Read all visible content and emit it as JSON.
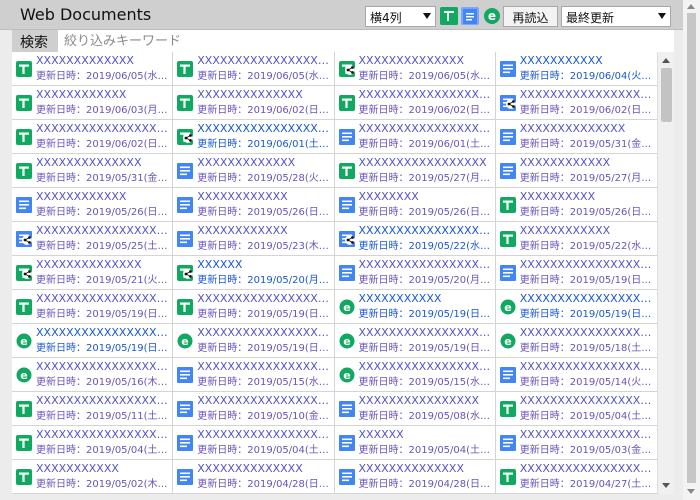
{
  "header": {
    "title": "Web Documents",
    "columns_select": "横4列",
    "reload_label": "再読込",
    "sort_select": "最終更新"
  },
  "search": {
    "label": "検索",
    "placeholder": "絞り込みキーワード"
  },
  "icons": {
    "sheets": {
      "name": "sheets-icon",
      "color": "#11a861"
    },
    "sheets-shared": {
      "name": "sheets-shared-icon",
      "color": "#11a861"
    },
    "docs": {
      "name": "docs-icon",
      "color": "#4285f4"
    },
    "docs-shared": {
      "name": "docs-shared-icon",
      "color": "#4285f4"
    },
    "e": {
      "name": "e-doc-icon",
      "color": "#11a861"
    }
  },
  "items": [
    {
      "type": "sheets",
      "name": "XXXXXXXXXXXXX",
      "meta": "更新日時：2019/06/05(水…",
      "new": false
    },
    {
      "type": "sheets",
      "name": "XXXXXXXXXXXXXXXXXX…",
      "meta": "更新日時：2019/06/05(水…",
      "new": false
    },
    {
      "type": "sheets-shared",
      "name": "XXXXXXXXXXXXXX",
      "meta": "更新日時：2019/06/05(水…",
      "new": false
    },
    {
      "type": "docs",
      "name": "XXXXXXXXXXX",
      "meta": "更新日時：2019/06/04(火…",
      "new": true
    },
    {
      "type": "sheets",
      "name": "XXXXXXXXXXXX",
      "meta": "更新日時：2019/06/03(月…",
      "new": false
    },
    {
      "type": "sheets",
      "name": "XXXXXXXXXXXXXX",
      "meta": "更新日時：2019/06/02(日…",
      "new": false
    },
    {
      "type": "sheets",
      "name": "XXXXXXXXXXXXXXXXXX…",
      "meta": "更新日時：2019/06/02(日…",
      "new": false
    },
    {
      "type": "docs-shared",
      "name": "XXXXXXXXXXXXXXXXXX…",
      "meta": "更新日時：2019/06/02(日…",
      "new": false
    },
    {
      "type": "sheets",
      "name": "XXXXXXXXXXXXXXXXXX…",
      "meta": "更新日時：2019/06/02(日…",
      "new": false
    },
    {
      "type": "sheets-shared",
      "name": "XXXXXXXXXXXXXXXXXX…",
      "meta": "更新日時：2019/06/01(土…",
      "new": true
    },
    {
      "type": "docs",
      "name": "XXXXXXXXXXXXXXXXXX…",
      "meta": "更新日時：2019/06/01(土…",
      "new": false
    },
    {
      "type": "docs",
      "name": "XXXXXXXXXXXXXX",
      "meta": "更新日時：2019/05/31(金…",
      "new": false
    },
    {
      "type": "sheets",
      "name": "XXXXXXXXXXXXXX",
      "meta": "更新日時：2019/05/31(金…",
      "new": false
    },
    {
      "type": "docs",
      "name": "XXXXXXXXXXXXX",
      "meta": "更新日時：2019/05/28(火…",
      "new": false
    },
    {
      "type": "sheets",
      "name": "XXXXXXXXXXXXXXXXX",
      "meta": "更新日時：2019/05/27(月…",
      "new": false
    },
    {
      "type": "docs",
      "name": "XXXXXXXXXXXX",
      "meta": "更新日時：2019/05/27(月…",
      "new": false
    },
    {
      "type": "docs",
      "name": "XXXXXXXXXXXX",
      "meta": "更新日時：2019/05/26(日…",
      "new": false
    },
    {
      "type": "docs",
      "name": "XXXXXXXXXXXX",
      "meta": "更新日時：2019/05/26(日…",
      "new": false
    },
    {
      "type": "docs",
      "name": "XXXXXXXX",
      "meta": "更新日時：2019/05/26(日…",
      "new": false
    },
    {
      "type": "sheets",
      "name": "XXXXXXXXXX",
      "meta": "更新日時：2019/05/26(日…",
      "new": false
    },
    {
      "type": "docs-shared",
      "name": "XXXXXXXXXXXXXXXXXX…",
      "meta": "更新日時：2019/05/25(土…",
      "new": false
    },
    {
      "type": "docs",
      "name": "XXXXXXXXXXXX",
      "meta": "更新日時：2019/05/23(木…",
      "new": false
    },
    {
      "type": "docs-shared",
      "name": "XXXXXXXXXXXXXXXXXX…",
      "meta": "更新日時：2019/05/22(水…",
      "new": true
    },
    {
      "type": "sheets",
      "name": "XXXXXXXXXXXX",
      "meta": "更新日時：2019/05/22(水…",
      "new": false
    },
    {
      "type": "sheets-shared",
      "name": "XXXXXXXXXXXXXX",
      "meta": "更新日時：2019/05/21(火…",
      "new": false
    },
    {
      "type": "sheets-shared",
      "name": "XXXXXX",
      "meta": "更新日時：2019/05/20(月…",
      "new": true
    },
    {
      "type": "docs",
      "name": "XXXXXXXXXXXXXXXXXX…",
      "meta": "更新日時：2019/05/20(月…",
      "new": false
    },
    {
      "type": "docs",
      "name": "XXXXXXXXXXXXXXXXXX…",
      "meta": "更新日時：2019/05/19(日…",
      "new": false
    },
    {
      "type": "sheets",
      "name": "XXXXXXXXXXXXXXXXXX…",
      "meta": "更新日時：2019/05/19(日…",
      "new": false
    },
    {
      "type": "sheets",
      "name": "XXXXXXXXXXXXXXXXXX…",
      "meta": "更新日時：2019/05/19(日…",
      "new": false
    },
    {
      "type": "e",
      "name": "XXXXXXXXXXX",
      "meta": "更新日時：2019/05/19(日…",
      "new": true
    },
    {
      "type": "e",
      "name": "XXXXXXXXXXXXXXXXXX…",
      "meta": "更新日時：2019/05/19(日…",
      "new": true
    },
    {
      "type": "e",
      "name": "XXXXXXXXXXXXXXXXXX…",
      "meta": "更新日時：2019/05/19(日…",
      "new": true
    },
    {
      "type": "e",
      "name": "XXXXXXXXXXXXXXXXXX…",
      "meta": "更新日時：2019/05/19(日…",
      "new": false
    },
    {
      "type": "e",
      "name": "XXXXXXXXXXXXXXXXXX…",
      "meta": "更新日時：2019/05/19(日…",
      "new": false
    },
    {
      "type": "e",
      "name": "XXXXXXXXXXXXXXXXXX…",
      "meta": "更新日時：2019/05/18(土…",
      "new": false
    },
    {
      "type": "e",
      "name": "XXXXXXXXXXXXXXXXXX…",
      "meta": "更新日時：2019/05/16(木…",
      "new": false
    },
    {
      "type": "docs",
      "name": "XXXXXXXXXXXXXXXXXX…",
      "meta": "更新日時：2019/05/15(水…",
      "new": false
    },
    {
      "type": "e",
      "name": "XXXXXXXXXXXXXXXXXX…",
      "meta": "更新日時：2019/05/15(水…",
      "new": false
    },
    {
      "type": "docs",
      "name": "XXXXXXXXXXXXXXXXXXX",
      "meta": "更新日時：2019/05/14(火…",
      "new": false
    },
    {
      "type": "sheets",
      "name": "XXXXXXXXXXXXXXXXXX…",
      "meta": "更新日時：2019/05/11(土…",
      "new": false
    },
    {
      "type": "docs",
      "name": "XXXXXXXXXXXXXXXXXX…",
      "meta": "更新日時：2019/05/10(金…",
      "new": false
    },
    {
      "type": "docs",
      "name": "XXXXXXXXXXXXXXXX",
      "meta": "更新日時：2019/05/08(水…",
      "new": false
    },
    {
      "type": "sheets",
      "name": "XXXXXXXXXXXXXXXXXX…",
      "meta": "更新日時：2019/05/04(土…",
      "new": false
    },
    {
      "type": "sheets",
      "name": "XXXXXXXXXXXXXXXXXX…",
      "meta": "更新日時：2019/05/04(土…",
      "new": false
    },
    {
      "type": "docs",
      "name": "XXXXXXXXXXXXXXXXXX…",
      "meta": "更新日時：2019/05/04(土…",
      "new": false
    },
    {
      "type": "docs",
      "name": "XXXXXX",
      "meta": "更新日時：2019/05/04(土…",
      "new": false
    },
    {
      "type": "docs",
      "name": "XXXXXXXXXXXXXXXXXX…",
      "meta": "更新日時：2019/05/03(金…",
      "new": false
    },
    {
      "type": "sheets",
      "name": "XXXXXXXXXXX",
      "meta": "更新日時：2019/05/02(木…",
      "new": false
    },
    {
      "type": "docs",
      "name": "XXXXXXXXXXXXXX",
      "meta": "更新日時：2019/04/28(日…",
      "new": false
    },
    {
      "type": "docs",
      "name": "XXXXXXXXXXXXXX",
      "meta": "更新日時：2019/04/28(日…",
      "new": false
    },
    {
      "type": "sheets",
      "name": "XXXXXXXXXXXXXXXX…",
      "meta": "更新日時：2019/04/27(土…",
      "new": false
    }
  ]
}
